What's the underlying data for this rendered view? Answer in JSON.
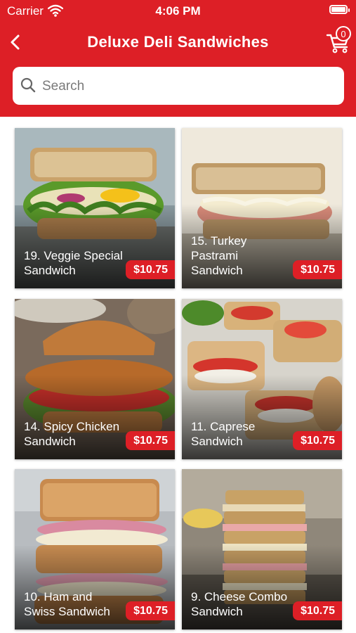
{
  "status_bar": {
    "carrier": "Carrier",
    "time": "4:06 PM"
  },
  "header": {
    "title": "Deluxe Deli Sandwiches",
    "cart_count": "0",
    "brand_color": "#dd1f26"
  },
  "search": {
    "placeholder": "Search",
    "value": ""
  },
  "products": [
    {
      "name": "19. Veggie Special Sandwich",
      "price": "$10.75",
      "image": "veggie-sandwich"
    },
    {
      "name": "15. Turkey Pastrami Sandwich",
      "price": "$10.75",
      "image": "turkey-pastrami-sandwich"
    },
    {
      "name": "14. Spicy Chicken Sandwich",
      "price": "$10.75",
      "image": "spicy-chicken-sandwich"
    },
    {
      "name": "11. Caprese Sandwich",
      "price": "$10.75",
      "image": "caprese-sandwich"
    },
    {
      "name": "10. Ham and Swiss Sandwich",
      "price": "$10.75",
      "image": "ham-swiss-sandwich"
    },
    {
      "name": "9. Cheese Combo Sandwich",
      "price": "$10.75",
      "image": "cheese-combo-sandwich"
    }
  ]
}
